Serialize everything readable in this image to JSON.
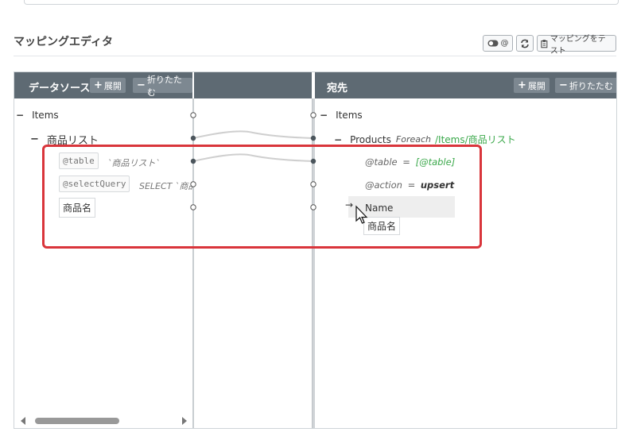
{
  "section": {
    "title": "マッピングエディタ"
  },
  "toolbar": {
    "at_label": "@",
    "mapping_test_label": "マッピングをテスト"
  },
  "source": {
    "header": "データソース",
    "expand": "展開",
    "collapse": "折りたたむ",
    "items_label": "Items",
    "product_list_label": "商品リスト",
    "table_param": "@table",
    "table_value": "`商品リスト`",
    "select_param": "@selectQuery",
    "select_value": "SELECT `商品",
    "product_name": "商品名"
  },
  "dest": {
    "header": "宛先",
    "expand": "展開",
    "collapse": "折りたたむ",
    "items_label": "Items",
    "products_label": "Products",
    "foreach_label": "Foreach",
    "foreach_path": "/Items/商品リスト",
    "table_attr": "@table",
    "table_eq": "=",
    "table_val": "[@table]",
    "action_attr": "@action",
    "action_eq": "=",
    "action_val": "upsert",
    "name_label": "Name",
    "drag_label": "商品名",
    "arrow": "→"
  },
  "colors": {
    "header": "#5e6a73",
    "header_button": "#7d8891",
    "highlight": "#d9353b",
    "green": "#3aa84a"
  }
}
